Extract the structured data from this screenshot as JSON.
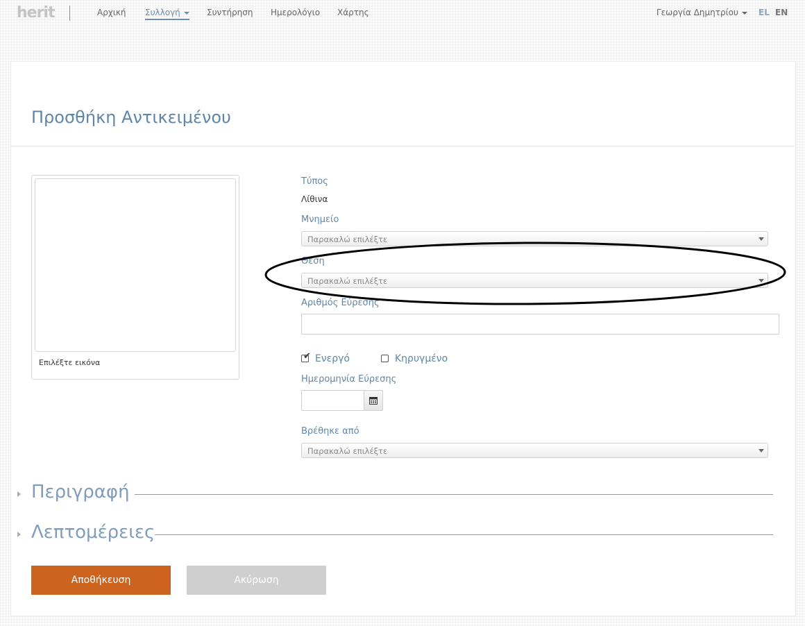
{
  "nav": {
    "logo": "herit",
    "items": [
      "Αρχική",
      "Συλλογή",
      "Συντήρηση",
      "Ημερολόγιο",
      "Χάρτης"
    ],
    "user": "Γεωργία Δημητρίου",
    "lang_el": "EL",
    "lang_en": "EN"
  },
  "page": {
    "title": "Προσθήκη Αντικειμένου"
  },
  "image_panel": {
    "label": "Επιλέξτε εικόνα"
  },
  "form": {
    "type_label": "Τύπος",
    "type_value": "Λίθινα",
    "monument_label": "Μνημείο",
    "monument_placeholder": "Παρακαλώ επιλέξτε",
    "position_label": "Θέση",
    "position_placeholder": "Παρακαλώ επιλέξτε",
    "find_number_label": "Αριθμός Εύρεσης",
    "active_label": "Ενεργό",
    "active_checked": true,
    "announced_label": "Κηρυγμένο",
    "announced_checked": false,
    "find_date_label": "Ημερομηνία Εύρεσης",
    "found_by_label": "Βρέθηκε από",
    "found_by_placeholder": "Παρακαλώ επιλέξτε"
  },
  "sections": {
    "description": "Περιγραφή",
    "details": "Λεπτομέρειες"
  },
  "buttons": {
    "save": "Αποθήκευση",
    "cancel": "Ακύρωση"
  },
  "colors": {
    "accent": "#5f86a8",
    "save": "#cc6420",
    "cancel": "#cfcfcf"
  }
}
